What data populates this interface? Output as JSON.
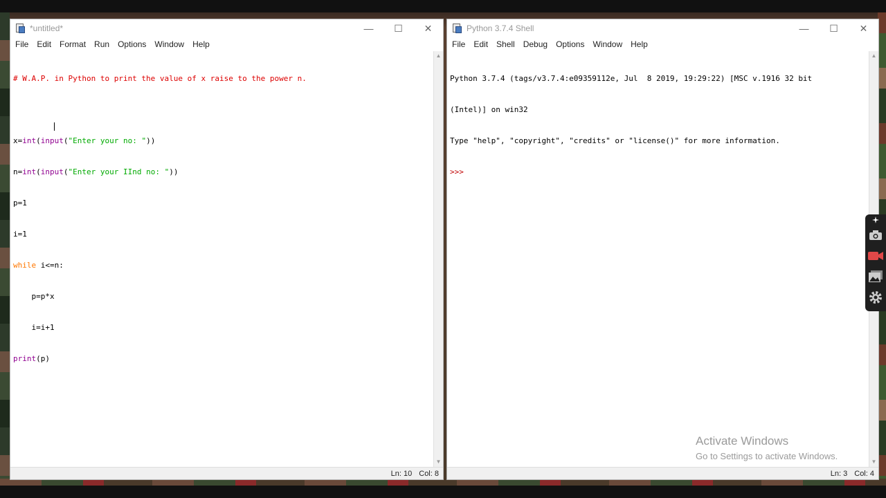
{
  "editor": {
    "title": "*untitled*",
    "menu": [
      "File",
      "Edit",
      "Format",
      "Run",
      "Options",
      "Window",
      "Help"
    ],
    "code": {
      "comment": "# W.A.P. in Python to print the value of x raise to the power n.",
      "line3": {
        "pre": "x=",
        "fn": "int",
        "open": "(",
        "fn2": "input",
        "open2": "(",
        "str": "\"Enter your no: \"",
        "close": "))"
      },
      "line4": {
        "pre": "n=",
        "fn": "int",
        "open": "(",
        "fn2": "input",
        "open2": "(",
        "str": "\"Enter your IInd no: \"",
        "close": "))"
      },
      "line5": "p=1",
      "line6": "i=1",
      "line7": {
        "kw": "while",
        "rest": " i<=n:"
      },
      "line8": "    p=p*x",
      "line9": "    i=i+1",
      "line10": {
        "fn": "print",
        "rest": "(p)"
      }
    },
    "status": {
      "ln": "Ln: 10",
      "col": "Col: 8"
    }
  },
  "shell": {
    "title": "Python 3.7.4 Shell",
    "menu": [
      "File",
      "Edit",
      "Shell",
      "Debug",
      "Options",
      "Window",
      "Help"
    ],
    "output": [
      "Python 3.7.4 (tags/v3.7.4:e09359112e, Jul  8 2019, 19:29:22) [MSC v.1916 32 bit",
      "(Intel)] on win32",
      "Type \"help\", \"copyright\", \"credits\" or \"license()\" for more information."
    ],
    "prompt": ">>>",
    "status": {
      "ln": "Ln: 3",
      "col": "Col: 4"
    }
  },
  "watermark": {
    "line1": "Activate Windows",
    "line2": "Go to Settings to activate Windows."
  },
  "window_controls": {
    "minimize": "—",
    "maximize": "☐",
    "close": "✕"
  },
  "colors": {
    "comment": "#dd0000",
    "builtin": "#900090",
    "string": "#00aa00",
    "keyword": "#ff7700",
    "prompt": "#c00000"
  },
  "icons": [
    "idle-icon",
    "camera-icon",
    "video-icon",
    "gallery-icon",
    "gear-icon"
  ]
}
